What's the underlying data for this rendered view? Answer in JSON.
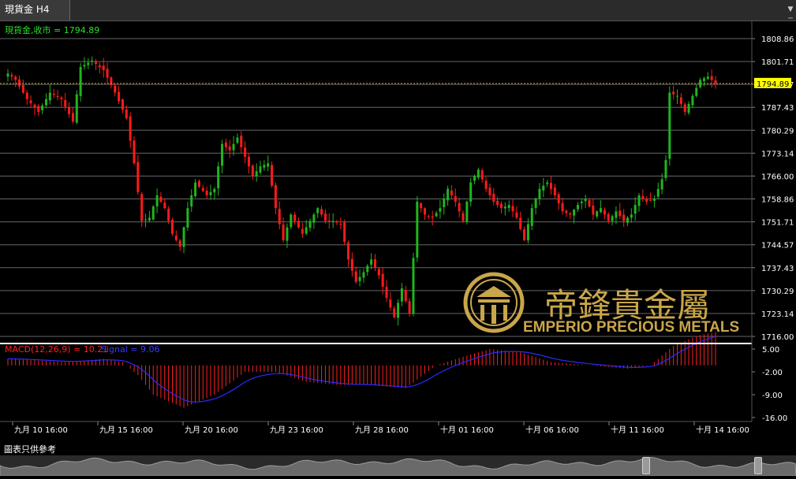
{
  "window": {
    "tab_title": "現貨金 H4",
    "menu_icon": "triangle-down-icon"
  },
  "watermark": {
    "chinese_text": "帝鋒貴金屬",
    "english_text": "EMPERIO PRECIOUS METALS",
    "logo_icon": "emperio-crest-icon"
  },
  "footer": {
    "disclaimer": "圖表只供參考"
  },
  "chart_data": [
    {
      "type": "candlestick",
      "label": "現貨金,收市 = 1794.89",
      "current_price": "1794.89",
      "price_ticks": [
        "1808.86",
        "1801.71",
        "1794.57",
        "1787.43",
        "1780.29",
        "1773.14",
        "1766.00",
        "1758.86",
        "1751.71",
        "1744.57",
        "1737.43",
        "1730.29",
        "1723.14",
        "1716.00"
      ],
      "ylim": [
        1716.0,
        1808.86
      ],
      "x_labels": [
        "九月 10 16:00",
        "九月 15 16:00",
        "九月 20 16:00",
        "九月 23 16:00",
        "九月 28 16:00",
        "十月 01 16:00",
        "十月 06 16:00",
        "十月 11 16:00",
        "十月 14 16:00"
      ],
      "grid": true,
      "colors": {
        "up": "#1fb51f",
        "down": "#ff1a1a",
        "current_line": "#c8a000",
        "label_box": "#ffff00"
      },
      "anchors": [
        {
          "i": 0,
          "c": 1798
        },
        {
          "i": 2,
          "c": 1796
        },
        {
          "i": 5,
          "c": 1790
        },
        {
          "i": 8,
          "c": 1786
        },
        {
          "i": 11,
          "c": 1792
        },
        {
          "i": 14,
          "c": 1790
        },
        {
          "i": 17,
          "c": 1783
        },
        {
          "i": 19,
          "c": 1800
        },
        {
          "i": 22,
          "c": 1802
        },
        {
          "i": 25,
          "c": 1799
        },
        {
          "i": 28,
          "c": 1792
        },
        {
          "i": 31,
          "c": 1784
        },
        {
          "i": 33,
          "c": 1770
        },
        {
          "i": 35,
          "c": 1752
        },
        {
          "i": 37,
          "c": 1753
        },
        {
          "i": 39,
          "c": 1760
        },
        {
          "i": 41,
          "c": 1756
        },
        {
          "i": 43,
          "c": 1748
        },
        {
          "i": 45,
          "c": 1744
        },
        {
          "i": 47,
          "c": 1756
        },
        {
          "i": 49,
          "c": 1764
        },
        {
          "i": 52,
          "c": 1760
        },
        {
          "i": 54,
          "c": 1762
        },
        {
          "i": 56,
          "c": 1776
        },
        {
          "i": 58,
          "c": 1774
        },
        {
          "i": 60,
          "c": 1778
        },
        {
          "i": 62,
          "c": 1772
        },
        {
          "i": 64,
          "c": 1766
        },
        {
          "i": 66,
          "c": 1769
        },
        {
          "i": 68,
          "c": 1770
        },
        {
          "i": 70,
          "c": 1756
        },
        {
          "i": 72,
          "c": 1746
        },
        {
          "i": 74,
          "c": 1754
        },
        {
          "i": 77,
          "c": 1748
        },
        {
          "i": 79,
          "c": 1752
        },
        {
          "i": 81,
          "c": 1756
        },
        {
          "i": 83,
          "c": 1752
        },
        {
          "i": 85,
          "c": 1752
        },
        {
          "i": 87,
          "c": 1751
        },
        {
          "i": 89,
          "c": 1740
        },
        {
          "i": 91,
          "c": 1733
        },
        {
          "i": 93,
          "c": 1736
        },
        {
          "i": 95,
          "c": 1740
        },
        {
          "i": 97,
          "c": 1735
        },
        {
          "i": 99,
          "c": 1728
        },
        {
          "i": 101,
          "c": 1722
        },
        {
          "i": 103,
          "c": 1731
        },
        {
          "i": 105,
          "c": 1723
        },
        {
          "i": 107,
          "c": 1758
        },
        {
          "i": 109,
          "c": 1754
        },
        {
          "i": 111,
          "c": 1753
        },
        {
          "i": 113,
          "c": 1756
        },
        {
          "i": 115,
          "c": 1762
        },
        {
          "i": 117,
          "c": 1758
        },
        {
          "i": 119,
          "c": 1752
        },
        {
          "i": 121,
          "c": 1764
        },
        {
          "i": 123,
          "c": 1768
        },
        {
          "i": 125,
          "c": 1762
        },
        {
          "i": 127,
          "c": 1758
        },
        {
          "i": 129,
          "c": 1756
        },
        {
          "i": 131,
          "c": 1757
        },
        {
          "i": 133,
          "c": 1753
        },
        {
          "i": 135,
          "c": 1746
        },
        {
          "i": 137,
          "c": 1756
        },
        {
          "i": 139,
          "c": 1762
        },
        {
          "i": 141,
          "c": 1764
        },
        {
          "i": 143,
          "c": 1760
        },
        {
          "i": 145,
          "c": 1755
        },
        {
          "i": 147,
          "c": 1754
        },
        {
          "i": 149,
          "c": 1757
        },
        {
          "i": 151,
          "c": 1759
        },
        {
          "i": 153,
          "c": 1754
        },
        {
          "i": 155,
          "c": 1756
        },
        {
          "i": 157,
          "c": 1752
        },
        {
          "i": 159,
          "c": 1755
        },
        {
          "i": 161,
          "c": 1752
        },
        {
          "i": 163,
          "c": 1754
        },
        {
          "i": 165,
          "c": 1760
        },
        {
          "i": 167,
          "c": 1758
        },
        {
          "i": 169,
          "c": 1759
        },
        {
          "i": 171,
          "c": 1765
        },
        {
          "i": 172,
          "c": 1771
        },
        {
          "i": 173,
          "c": 1792
        },
        {
          "i": 175,
          "c": 1791
        },
        {
          "i": 177,
          "c": 1786
        },
        {
          "i": 179,
          "c": 1791
        },
        {
          "i": 181,
          "c": 1796
        },
        {
          "i": 183,
          "c": 1797
        },
        {
          "i": 185,
          "c": 1794.89
        }
      ]
    },
    {
      "type": "bar",
      "label": "MACD(12,26,9) = 10.21",
      "signal_label": "Signal = 9.06",
      "value_ticks": [
        "5.00",
        "-2.00",
        "-9.00",
        "-16.00"
      ],
      "ylim": [
        -16.0,
        5.0
      ],
      "colors": {
        "macd": "#ff2020",
        "signal": "#2a2aff"
      },
      "anchors": [
        {
          "i": 0,
          "m": 2
        },
        {
          "i": 15,
          "m": 1
        },
        {
          "i": 25,
          "m": 2
        },
        {
          "i": 30,
          "m": 1
        },
        {
          "i": 34,
          "m": -3
        },
        {
          "i": 38,
          "m": -9
        },
        {
          "i": 46,
          "m": -13
        },
        {
          "i": 54,
          "m": -9
        },
        {
          "i": 62,
          "m": -2
        },
        {
          "i": 70,
          "m": -2
        },
        {
          "i": 78,
          "m": -5
        },
        {
          "i": 86,
          "m": -6
        },
        {
          "i": 94,
          "m": -6
        },
        {
          "i": 104,
          "m": -7
        },
        {
          "i": 112,
          "m": 0
        },
        {
          "i": 120,
          "m": 3
        },
        {
          "i": 126,
          "m": 5
        },
        {
          "i": 134,
          "m": 4
        },
        {
          "i": 142,
          "m": 1
        },
        {
          "i": 152,
          "m": 0
        },
        {
          "i": 162,
          "m": -1
        },
        {
          "i": 168,
          "m": 0
        },
        {
          "i": 174,
          "m": 6
        },
        {
          "i": 180,
          "m": 9
        },
        {
          "i": 185,
          "m": 10.21
        }
      ]
    }
  ]
}
